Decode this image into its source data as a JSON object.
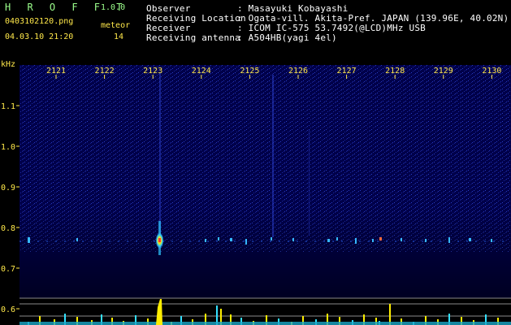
{
  "app": {
    "title": "H R O F F T",
    "version": "1.0.0",
    "filename": "0403102120.png",
    "datetime": "04.03.10 21:20",
    "meteor_label": "meteor",
    "meteor_count": "14"
  },
  "info": {
    "rows": [
      {
        "label": "Observer",
        "value": ": Masayuki Kobayashi"
      },
      {
        "label": "Receiving Location",
        "value": ": Ogata-vill. Akita-Pref. JAPAN (139.96E, 40.02N)"
      },
      {
        "label": "Receiver",
        "value": ": ICOM IC-575 53.7492(@LCD)MHz USB"
      },
      {
        "label": "Receiving antenna",
        "value": ": A504HB(yagi 4el)"
      }
    ]
  },
  "spectrogram": {
    "y_unit": "kHz",
    "y_ticks": [
      "1.1",
      "1.0",
      "0.9",
      "0.8",
      "0.7",
      "0.6"
    ],
    "time_ticks": [
      "2121",
      "2122",
      "2123",
      "2124",
      "2125",
      "2126",
      "2127",
      "2128",
      "2129",
      "2130"
    ],
    "colors": {
      "background": "#00004a",
      "noise": "#1a2aa8",
      "echo_low": "#2ec6ff",
      "echo_high": "#ff3a2a",
      "text": "#ffe84a",
      "level_bars": "#ffee00",
      "level_base": "#34e0ff"
    }
  }
}
